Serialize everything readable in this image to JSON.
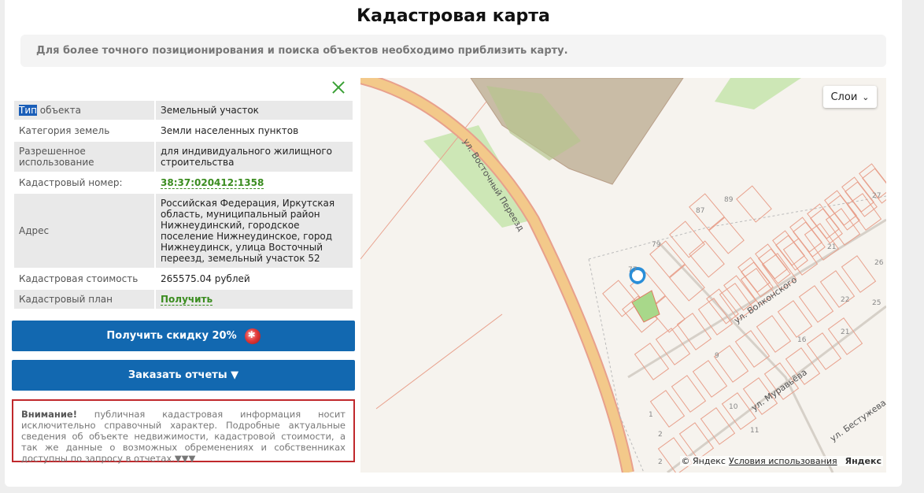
{
  "page": {
    "title": "Кадастровая карта",
    "notice": "Для более точного позиционирования и поиска объектов необходимо приблизить карту."
  },
  "info": {
    "rows": [
      {
        "key_highlight": "Тип",
        "key_rest": " объекта",
        "value": "Земельный участок"
      },
      {
        "key": "Категория земель",
        "value": "Земли населенных пунктов"
      },
      {
        "key": "Разрешенное использование",
        "value": "для индивидуального жилищного строительства"
      },
      {
        "key": "Кадастровый номер:",
        "value": "38:37:020412:1358"
      },
      {
        "key": "Адрес",
        "value": "Российская Федерация, Иркутская область, муниципальный район Нижнеудинский, городское поселение Нижнеудинское, город Нижнеудинск, улица Восточный переезд, земельный участок 52"
      },
      {
        "key": "Кадастровая стоимость",
        "value": "265575.04 рублей"
      },
      {
        "key": "Кадастровый план",
        "value": "Получить"
      }
    ]
  },
  "buttons": {
    "discount": "Получить скидку 20%",
    "order_reports": "Заказать отчеты ▼"
  },
  "warning": {
    "lead": "Внимание!",
    "text": " публичная кадастровая информация носит исключительно справочный характер. Подробные актуальные сведения об объекте недвижимости, кадастровой стоимости, а так же данные о возможных обременениях и собственниках доступны по запросу в отчетах.▼▼▼"
  },
  "map": {
    "layers_label": "Слои",
    "copyright": "© Яндекс",
    "terms": "Условия использования",
    "logo": "Яндекс",
    "streets": [
      "ул. Восточный Переезд",
      "ул. Волконского",
      "ул. Муравьёва",
      "ул. Бестужева"
    ],
    "parcel_numbers": [
      "89",
      "87",
      "79",
      "77",
      "27",
      "21",
      "26",
      "22",
      "25",
      "21",
      "16",
      "9",
      "10",
      "11",
      "1",
      "2",
      "2"
    ],
    "colors": {
      "parcel": "#e8a08c",
      "selected": "#a8d88a",
      "road": "#f3c98a",
      "marker": "#2a8ed8"
    }
  }
}
